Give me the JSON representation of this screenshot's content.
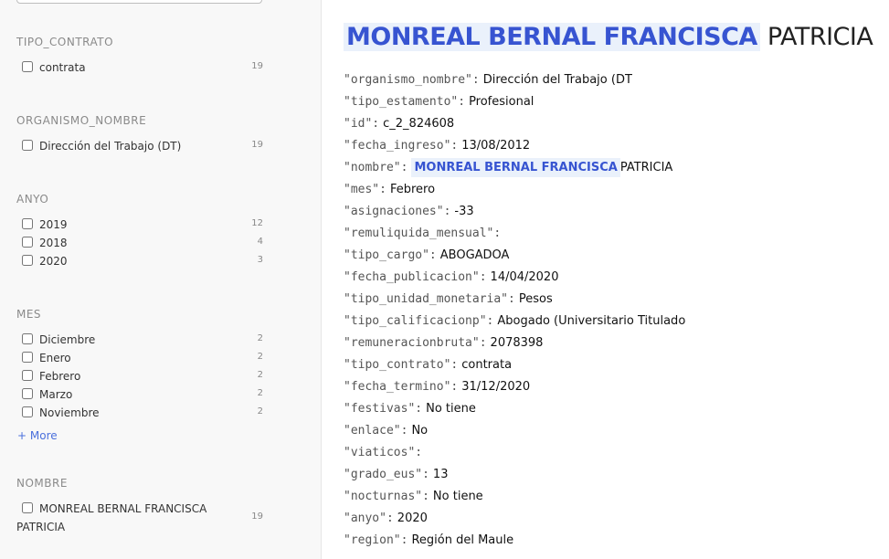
{
  "sidebar": {
    "facets": [
      {
        "title": "TIPO_CONTRATO",
        "items": [
          {
            "label": "contrata",
            "count": "19"
          }
        ]
      },
      {
        "title": "ORGANISMO_NOMBRE",
        "items": [
          {
            "label": "Dirección del Trabajo (DT)",
            "count": "19"
          }
        ]
      },
      {
        "title": "ANYO",
        "items": [
          {
            "label": "2019",
            "count": "12"
          },
          {
            "label": "2018",
            "count": "4"
          },
          {
            "label": "2020",
            "count": "3"
          }
        ]
      },
      {
        "title": "MES",
        "items": [
          {
            "label": "Diciembre",
            "count": "2"
          },
          {
            "label": "Enero",
            "count": "2"
          },
          {
            "label": "Febrero",
            "count": "2"
          },
          {
            "label": "Marzo",
            "count": "2"
          },
          {
            "label": "Noviembre",
            "count": "2"
          }
        ],
        "more": "+ More"
      },
      {
        "title": "NOMBRE",
        "items": [
          {
            "label": "MONREAL BERNAL FRANCISCA PATRICIA",
            "count": "19"
          }
        ]
      }
    ]
  },
  "main": {
    "title_highlight": "MONREAL BERNAL FRANCISCA",
    "title_rest": "PATRICIA",
    "fields": [
      {
        "key": "\"organismo_nombre\":",
        "value": "Dirección del Trabajo (DT"
      },
      {
        "key": "\"tipo_estamento\":",
        "value": "Profesional"
      },
      {
        "key": "\"id\":",
        "value": "c_2_824608"
      },
      {
        "key": "\"fecha_ingreso\":",
        "value": "13/08/2012"
      },
      {
        "key": "\"nombre\":",
        "value_highlight": "MONREAL BERNAL FRANCISCA",
        "value": "PATRICIA"
      },
      {
        "key": "\"mes\":",
        "value": "Febrero"
      },
      {
        "key": "\"asignaciones\":",
        "value": "-33"
      },
      {
        "key": "\"remuliquida_mensual\":",
        "value": ""
      },
      {
        "key": "\"tipo_cargo\":",
        "value": "ABOGADOA"
      },
      {
        "key": "\"fecha_publicacion\":",
        "value": "14/04/2020"
      },
      {
        "key": "\"tipo_unidad_monetaria\":",
        "value": "Pesos"
      },
      {
        "key": "\"tipo_calificacionp\":",
        "value": "Abogado (Universitario Titulado"
      },
      {
        "key": "\"remuneracionbruta\":",
        "value": "2078398"
      },
      {
        "key": "\"tipo_contrato\":",
        "value": "contrata"
      },
      {
        "key": "\"fecha_termino\":",
        "value": "31/12/2020"
      },
      {
        "key": "\"festivas\":",
        "value": "No tiene"
      },
      {
        "key": "\"enlace\":",
        "value": "No"
      },
      {
        "key": "\"viaticos\":",
        "value": ""
      },
      {
        "key": "\"grado_eus\":",
        "value": "13"
      },
      {
        "key": "\"nocturnas\":",
        "value": "No tiene"
      },
      {
        "key": "\"anyo\":",
        "value": "2020"
      },
      {
        "key": "\"region\":",
        "value": "Región del Maule"
      }
    ]
  },
  "colors": {
    "highlight_text": "#3754d1",
    "highlight_bg": "#eaf1fb",
    "link": "#4a6fdc"
  }
}
